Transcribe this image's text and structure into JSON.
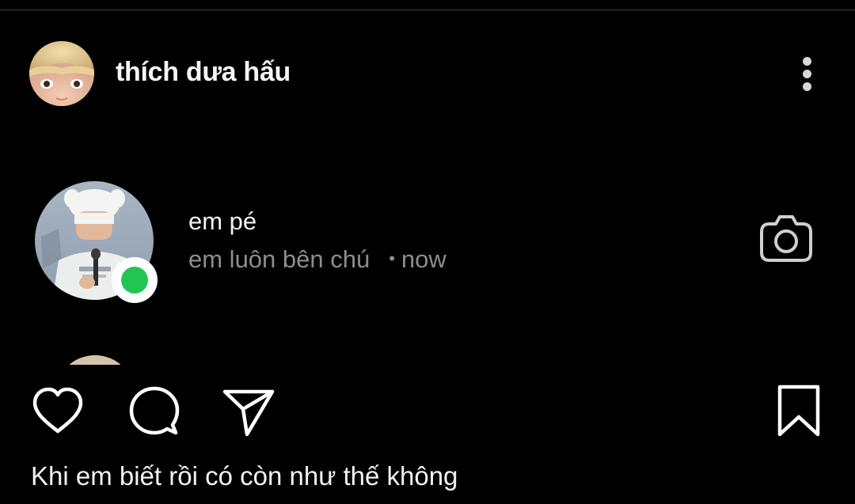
{
  "post": {
    "author": {
      "username": "thích dưa hấu",
      "avatar_icon": "profile-photo"
    },
    "more_icon": "more-vertical-icon",
    "media": {
      "chat": {
        "name": "em pé",
        "preview": "em luôn bên chú",
        "separator": "•",
        "time": "now",
        "online_color": "#23c552",
        "camera_icon": "camera-icon"
      }
    },
    "actions": {
      "like_icon": "heart-icon",
      "comment_icon": "comment-icon",
      "share_icon": "send-icon",
      "save_icon": "bookmark-icon"
    },
    "caption": "Khi em biết rồi có còn như thế không"
  },
  "colors": {
    "background": "#000000",
    "primary_text": "#f5f5f5",
    "secondary_text": "#8d8d8d",
    "online": "#23c552"
  }
}
